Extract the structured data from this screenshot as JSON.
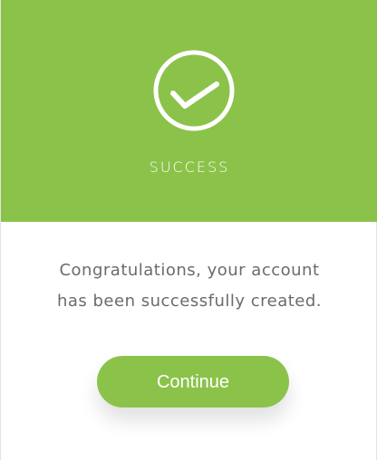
{
  "header": {
    "title": "SUCCESS",
    "icon": "check-circle-icon",
    "background_color": "#8bc34a"
  },
  "message": {
    "line1": "Congratulations, your account",
    "line2": "has been successfully created."
  },
  "actions": {
    "continue_label": "Continue",
    "button_color": "#8bc34a"
  }
}
